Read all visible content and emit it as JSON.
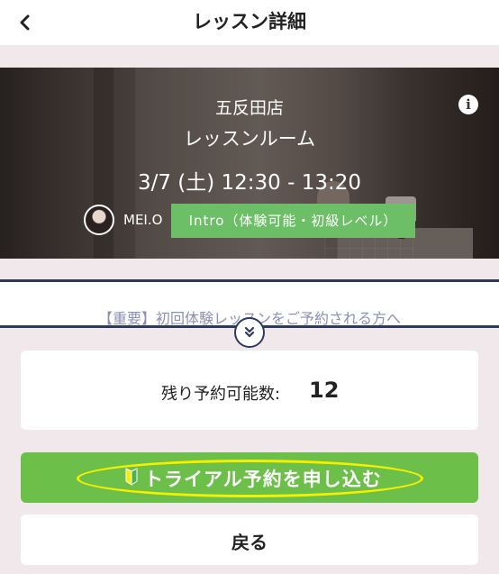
{
  "header": {
    "title": "レッスン詳細",
    "back_icon": "chevron-left-icon"
  },
  "lesson": {
    "store": "五反田店",
    "room": "レッスンルーム",
    "datetime": "3/7 (土) 12:30 - 13:20",
    "instructor": "MEI.O",
    "level": "Intro（体験可能・初級レベル）",
    "info_icon": "info-icon",
    "info_symbol": "i"
  },
  "notice": {
    "text": "【重要】初回体験レッスンをご予約される方へ",
    "expand_icon": "double-chevron-down-icon"
  },
  "availability": {
    "label": "残り予約可能数:",
    "count": "12"
  },
  "actions": {
    "trial_label": "トライアル予約を申し込む",
    "trial_icon": "beginner-mark-icon",
    "back_label": "戻る"
  },
  "colors": {
    "accent_green": "#6cbf48",
    "level_green": "#6cbf66",
    "navy": "#2c3a5e",
    "background": "#f0e8ea",
    "highlight": "#f4f000"
  }
}
